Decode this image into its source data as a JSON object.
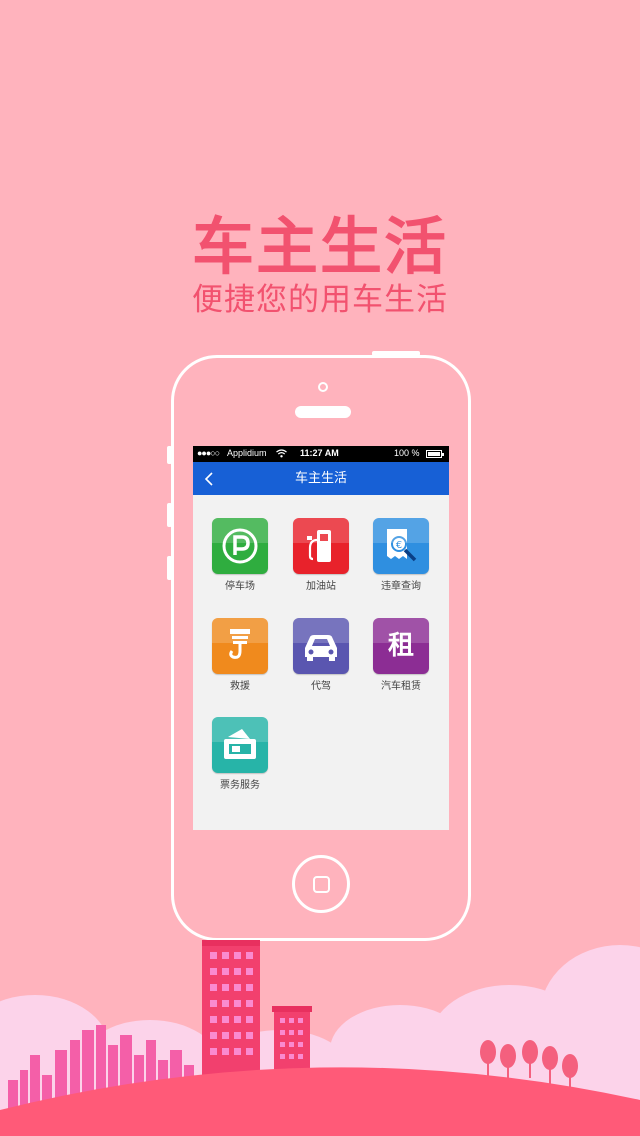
{
  "promo": {
    "headline": "车主生活",
    "subline": "便捷您的用车生活"
  },
  "status_bar": {
    "signal": "●●●○○",
    "carrier": "Applidium",
    "time": "11:27 AM",
    "battery": "100 %"
  },
  "nav": {
    "title": "车主生活",
    "back_icon": "chevron-left-icon"
  },
  "services": [
    {
      "label": "停车场",
      "icon": "parking-icon",
      "color": "#2fad3f"
    },
    {
      "label": "加油站",
      "icon": "fuel-pump-icon",
      "color": "#e8222b"
    },
    {
      "label": "违章查询",
      "icon": "ticket-search-icon",
      "color": "#2f8fe0"
    },
    {
      "label": "救援",
      "icon": "tow-hook-icon",
      "color": "#f08a1d"
    },
    {
      "label": "代驾",
      "icon": "car-icon",
      "color": "#5a56b0"
    },
    {
      "label": "汽车租赁",
      "icon": "rental-icon",
      "color": "#8c2d94",
      "glyph": "租"
    },
    {
      "label": "票务服务",
      "icon": "ticket-icon",
      "color": "#27b4a8"
    }
  ],
  "colors": {
    "background": "#ffb3bd",
    "accent": "#f2526f",
    "nav_bar": "#1760d6",
    "ground": "#ff5a78"
  }
}
